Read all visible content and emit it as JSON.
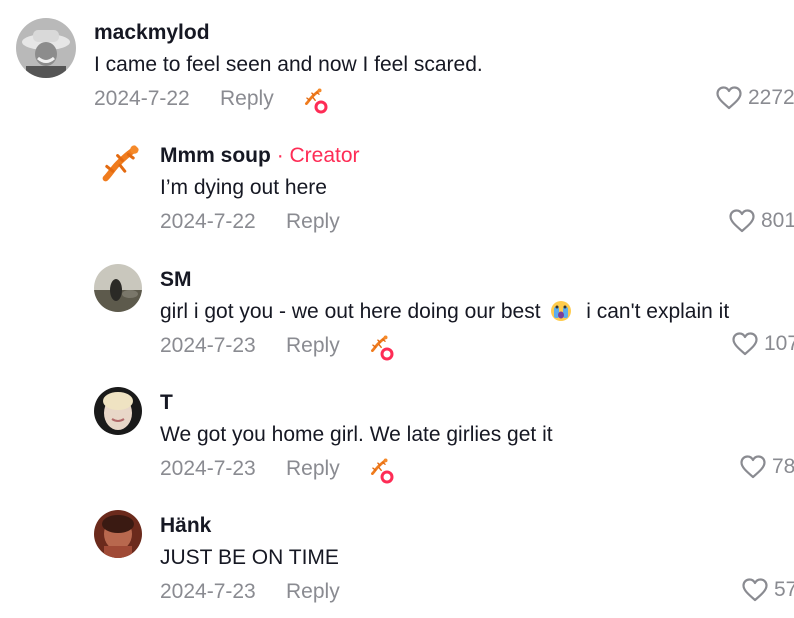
{
  "comments": [
    {
      "username": "mackmylod",
      "text": "I came to feel seen and now I feel scared.",
      "date": "2024-7-22",
      "reply": "Reply",
      "likes": "2272",
      "creator_liked": true
    },
    {
      "username": "Mmm soup",
      "creator_badge": "· Creator",
      "text": "I’m dying out here",
      "date": "2024-7-22",
      "reply": "Reply",
      "likes": "801",
      "creator_liked": false
    },
    {
      "username": "SM",
      "text_before": "girl i got you - we out here doing our best",
      "emoji": "crying-face-emoji",
      "text_after": "i can't explain it",
      "date": "2024-7-23",
      "reply": "Reply",
      "likes": "107",
      "creator_liked": true
    },
    {
      "username": "T",
      "text": "We got you home girl. We late girlies get it",
      "date": "2024-7-23",
      "reply": "Reply",
      "likes": "78",
      "creator_liked": true
    },
    {
      "username": "Hänk",
      "text": "JUST BE ON TIME",
      "date": "2024-7-23",
      "reply": "Reply",
      "likes": "57",
      "creator_liked": false
    }
  ],
  "colors": {
    "accent": "#fe2c55",
    "muted": "#8a8b91",
    "text": "#161823",
    "salamander": "#f07c1e"
  }
}
